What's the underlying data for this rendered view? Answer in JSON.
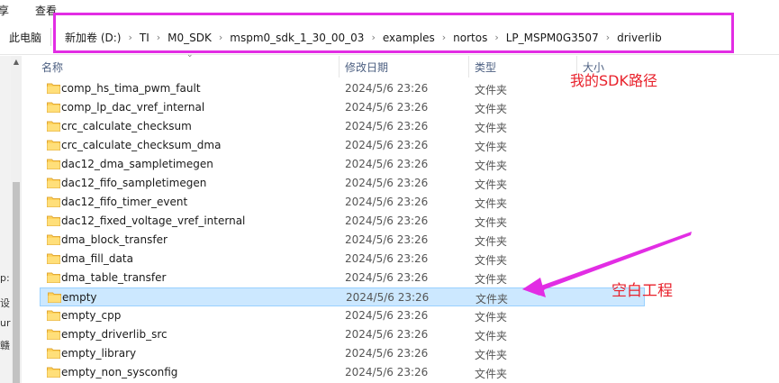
{
  "menu": {
    "share": "享",
    "view": "查看"
  },
  "address": {
    "root": "此电脑",
    "crumbs": [
      "新加卷 (D:)",
      "TI",
      "M0_SDK",
      "mspm0_sdk_1_30_00_03",
      "examples",
      "nortos",
      "LP_MSPM0G3507",
      "driverlib"
    ]
  },
  "columns": {
    "name": "名称",
    "modified": "修改日期",
    "type": "类型",
    "size": "大小"
  },
  "left_fragments": [
    "p:",
    "设",
    "ur",
    "赣"
  ],
  "files": [
    {
      "name": "comp_hs_tima_pwm_fault",
      "modified": "2024/5/6 23:26",
      "type": "文件夹"
    },
    {
      "name": "comp_lp_dac_vref_internal",
      "modified": "2024/5/6 23:26",
      "type": "文件夹"
    },
    {
      "name": "crc_calculate_checksum",
      "modified": "2024/5/6 23:26",
      "type": "文件夹"
    },
    {
      "name": "crc_calculate_checksum_dma",
      "modified": "2024/5/6 23:26",
      "type": "文件夹"
    },
    {
      "name": "dac12_dma_sampletimegen",
      "modified": "2024/5/6 23:26",
      "type": "文件夹"
    },
    {
      "name": "dac12_fifo_sampletimegen",
      "modified": "2024/5/6 23:26",
      "type": "文件夹"
    },
    {
      "name": "dac12_fifo_timer_event",
      "modified": "2024/5/6 23:26",
      "type": "文件夹"
    },
    {
      "name": "dac12_fixed_voltage_vref_internal",
      "modified": "2024/5/6 23:26",
      "type": "文件夹"
    },
    {
      "name": "dma_block_transfer",
      "modified": "2024/5/6 23:26",
      "type": "文件夹"
    },
    {
      "name": "dma_fill_data",
      "modified": "2024/5/6 23:26",
      "type": "文件夹"
    },
    {
      "name": "dma_table_transfer",
      "modified": "2024/5/6 23:26",
      "type": "文件夹"
    },
    {
      "name": "empty",
      "modified": "2024/5/6 23:26",
      "type": "文件夹",
      "selected": true
    },
    {
      "name": "empty_cpp",
      "modified": "2024/5/6 23:26",
      "type": "文件夹"
    },
    {
      "name": "empty_driverlib_src",
      "modified": "2024/5/6 23:26",
      "type": "文件夹"
    },
    {
      "name": "empty_library",
      "modified": "2024/5/6 23:26",
      "type": "文件夹"
    },
    {
      "name": "empty_non_sysconfig",
      "modified": "2024/5/6 23:26",
      "type": "文件夹"
    }
  ],
  "annotations": {
    "sdk_path": "我的SDK路径",
    "empty_project": "空白工程"
  },
  "colors": {
    "annotation_text": "#e8212b",
    "highlight_box": "#e22de4",
    "arrow": "#e22de4",
    "selection_bg": "#cce8ff",
    "folder": "#ffd35c"
  },
  "icons": {
    "folder": "folder-icon",
    "breadcrumb_separator": "chevron-right-icon"
  }
}
